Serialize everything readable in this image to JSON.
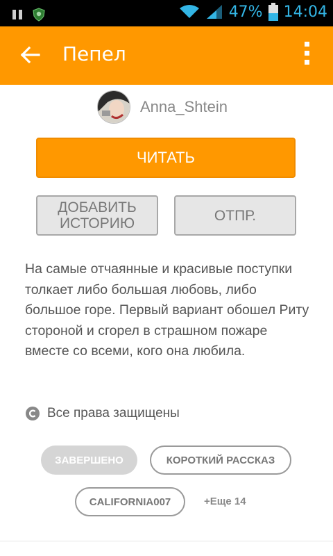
{
  "status_bar": {
    "battery": "47%",
    "time": "14:04"
  },
  "app_bar": {
    "title": "Пепел"
  },
  "author": {
    "name": "Anna_Shtein"
  },
  "actions": {
    "read_label": "ЧИТАТЬ",
    "add_story_label": "ДОБАВИТЬ ИСТОРИЮ",
    "send_label": "ОТПР."
  },
  "description": "На самые отчаянные и красивые поступки толкает либо большая любовь, либо большое горе. Первый вариант обошел Риту стороной и сгорел в страшном пожаре вместе со всеми, кого она любила.",
  "copyright": {
    "icon": "copyright-icon",
    "text": "Все права защищены"
  },
  "tags": {
    "status": "ЗАВЕРШЕНО",
    "items": [
      "КОРОТКИЙ РАССКАЗ",
      "CALIFORNIA007"
    ],
    "more": "+Еще 14"
  },
  "colors": {
    "accent": "#ff9800",
    "status_bar_text": "#33b5e5"
  }
}
